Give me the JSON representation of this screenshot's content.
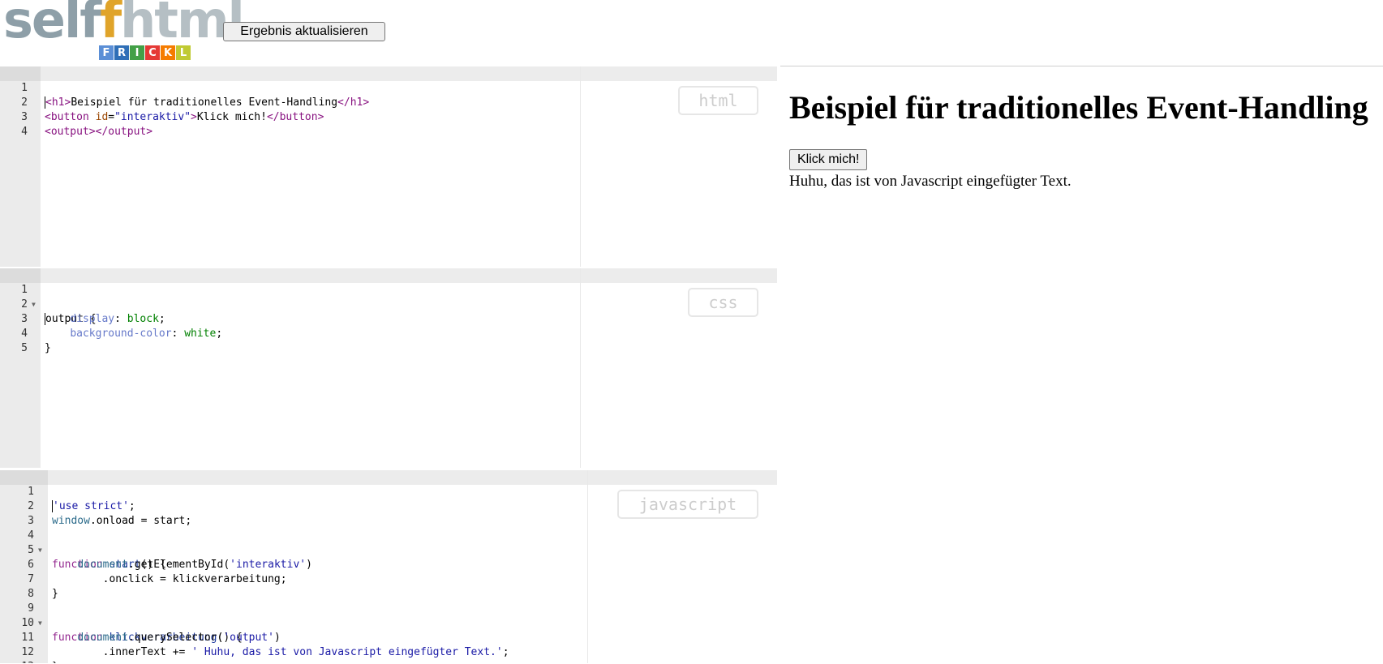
{
  "header": {
    "logo": {
      "self": "self",
      "f": "f",
      "html": "html",
      "tiles": [
        "F",
        "R",
        "I",
        "C",
        "K",
        "L"
      ]
    },
    "update_button": "Ergebnis aktualisieren"
  },
  "colors": {
    "tiles": [
      "#5b8fd6",
      "#2f6fb7",
      "#43a047",
      "#e53935",
      "#f57c00",
      "#c0ca33"
    ]
  },
  "editors": {
    "html": {
      "mode_label": "html",
      "lines": [
        "<h1>Beispiel für traditionelles Event-Handling</h1>",
        "<button id=\"interaktiv\">Klick mich!</button>",
        "<output></output>",
        ""
      ]
    },
    "css": {
      "mode_label": "css",
      "lines": [
        "output {",
        "    display: block;",
        "    background-color: white;",
        "}",
        ""
      ]
    },
    "javascript": {
      "mode_label": "javascript",
      "lines": [
        "'use strict';",
        "window.onload = start;",
        "",
        "function start() {",
        "    document.getElementById('interaktiv')",
        "        .onclick = klickverarbeitung;",
        "}",
        "",
        "function klickverarbeitung() {",
        "    document.querySelector('output')",
        "        .innerText += ' Huhu, das ist von Javascript eingefügter Text.';",
        "}",
        ""
      ]
    }
  },
  "preview": {
    "heading": "Beispiel für traditionelles Event-Handling",
    "button": "Klick mich!",
    "output": "Huhu, das ist von Javascript eingefügter Text."
  }
}
